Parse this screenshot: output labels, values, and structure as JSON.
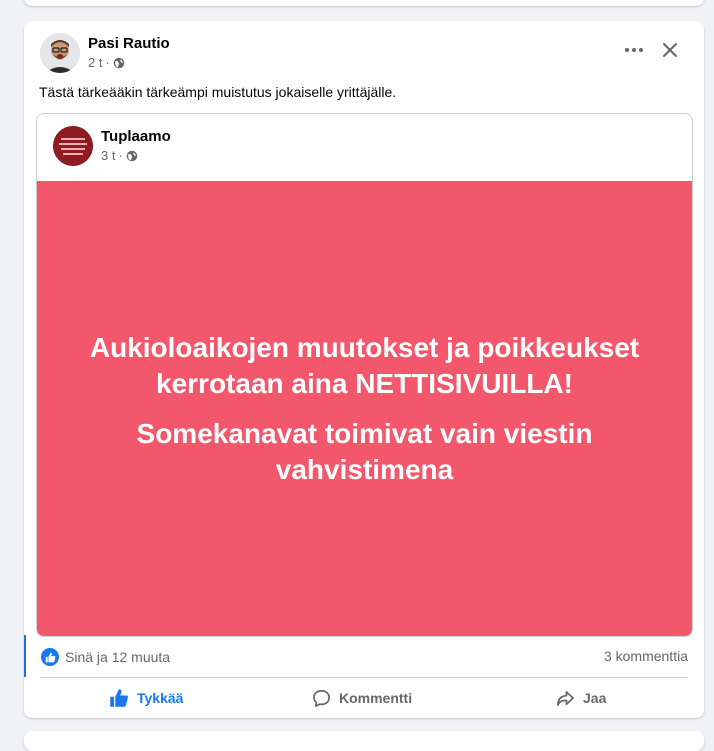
{
  "post": {
    "author": "Pasi Rautio",
    "time": "2 t",
    "text": "Tästä tärkeääkin tärkeämpi muistutus jokaiselle yrittäjälle.",
    "shared": {
      "page_name": "Tuplaamo",
      "time": "3 t",
      "banner_color": "#f2576b",
      "banner_lines_1": [
        "Aukioloaikojen muutokset ja poikkeukset",
        "kerrotaan aina NETTISIVUILLA!"
      ],
      "banner_lines_2": [
        "Somekanavat toimivat vain viestin",
        "vahvistimena"
      ]
    },
    "reactions_text": "Sinä ja 12 muuta",
    "comments_count": "3 kommenttia",
    "actions": {
      "like": "Tykkää",
      "comment": "Kommentti",
      "share": "Jaa"
    }
  },
  "colors": {
    "accent": "#1877f2",
    "background": "#f0f2f5",
    "secondary_text": "#65676b"
  },
  "icons": {
    "privacy": "globe-icon",
    "more": "more-horizontal-icon",
    "close": "close-icon",
    "like": "thumbs-up-icon",
    "comment": "comment-icon",
    "share": "share-icon"
  }
}
